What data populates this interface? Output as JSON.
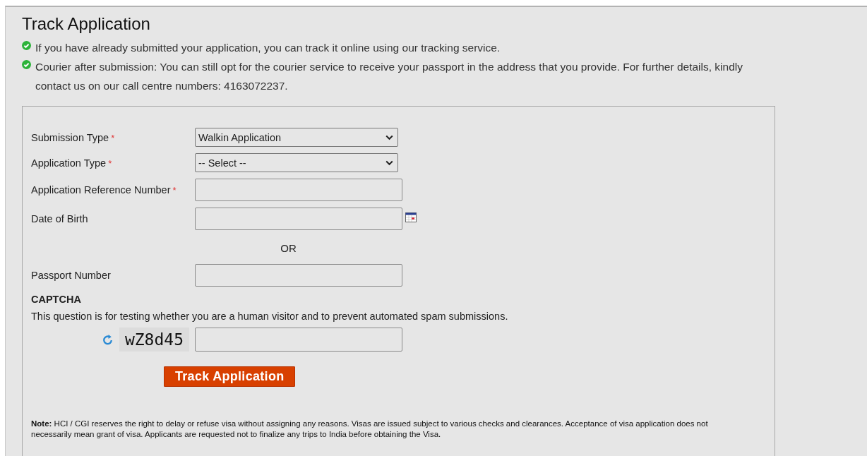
{
  "page": {
    "title": "Track Application"
  },
  "notices": [
    "If you have already submitted your application, you can track it online using our tracking service.",
    "Courier after submission: You can still opt for the courier service to receive your passport in the address that you provide. For further details, kindly contact us on our call centre numbers: 4163072237."
  ],
  "form": {
    "fields": [
      {
        "kind": "select",
        "label": "Submission Type",
        "marker": "*",
        "value": "Walkin Application"
      },
      {
        "kind": "select",
        "label": "Application Type",
        "marker": "*",
        "value": "-- Select --"
      },
      {
        "kind": "text",
        "label": "Application Reference Number",
        "marker": "*"
      },
      {
        "kind": "date",
        "label": "Date of Birth"
      },
      {
        "kind": "separator",
        "label": "OR"
      },
      {
        "kind": "text",
        "label": "Passport Number"
      }
    ],
    "captcha": {
      "heading": "CAPTCHA",
      "description": "This question is for testing whether you are a human visitor and to prevent automated spam submissions.",
      "code": "wZ8d45"
    },
    "submit": "Track Application",
    "note": "**Note:** HCI / CGI reserves the right to delay or refuse visa without assigning any reasons. Visas are issued subject to various checks and clearances. Acceptance of visa application does not necessarily mean grant of visa. Applicants are requested not to finalize any trips to India before obtaining the Visa."
  }
}
